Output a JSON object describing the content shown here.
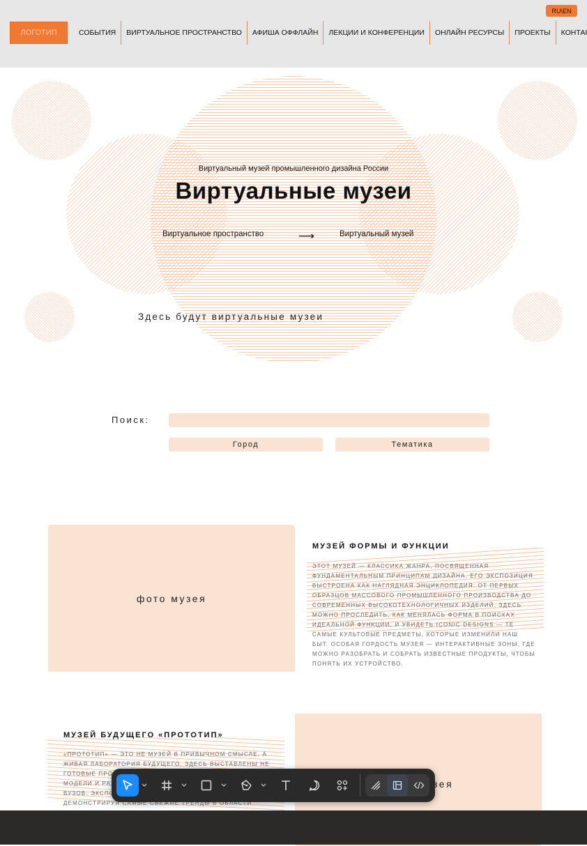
{
  "header": {
    "logo": "ЛОГОТИП",
    "lang": "RU\\EN",
    "nav": [
      {
        "label": "СОБЫТИЯ"
      },
      {
        "label": "ВИРТУАЛЬНОЕ ПРОСТРАНСТВО"
      },
      {
        "label": "АФИША ОФФЛАЙН"
      },
      {
        "label": "ЛЕКЦИИ И КОНФЕРЕНЦИИ"
      },
      {
        "label": "ОНЛАЙН РЕСУРСЫ"
      },
      {
        "label": "ПРОЕКТЫ"
      },
      {
        "label": "КОНТАКТЫ"
      }
    ]
  },
  "hero": {
    "subtitle": "Виртуальный музей промышленного дизайна России",
    "title": "Виртуальные музеи",
    "from": "Виртуальное пространство",
    "arrow": "⟶",
    "to": "Виртуальный музей",
    "note": "Здесь будут виртуальные музеи"
  },
  "search": {
    "label": "Поиск:",
    "value": "",
    "placeholder": "",
    "filters": [
      "Город",
      "Тематика"
    ]
  },
  "museums": [
    {
      "photo": "фото музея",
      "title": "МУЗЕЙ ФОРМЫ И ФУНКЦИИ",
      "text": "Этот музей — классика жанра, посвященная фундаментальным принципам дизайна. Его экспозиция выстроена как наглядная энциклопедия: от первых образцов массового промышленного производства до современных высокотехнологичных изделий. Здесь можно проследить, как менялась форма в поисках идеальной функции, и увидеть iconic designs — те самые культовые предметы, которые изменили наш быт. Особая гордость музея — интерактивные зоны, где можно разобрать и собрать известные продукты, чтобы понять их устройство."
    },
    {
      "photo": "фото музея",
      "title": "МУЗЕЙ БУДУЩЕГО «ПРОТОТИП»",
      "text": "«Прототип» — это не музей в привычном смысле, а живая лаборатория будущего. Здесь выставлены не готовые продукты, а концепции, прототипы, модели и разработки молодых дизайнеров, студий и вузов. Экспозиция постоянно обновляется, демонстрируя самые свежие тренды в области"
    }
  ],
  "toolbar": {
    "tools": [
      "move-tool",
      "frame-tool",
      "shape-tool",
      "pen-tool",
      "text-tool",
      "comment-tool",
      "components-tool"
    ],
    "modes": [
      "draw-mode",
      "design-mode",
      "dev-mode"
    ],
    "active_tool": "move-tool",
    "active_mode": "design-mode",
    "accent": "#1a8cff"
  },
  "colors": {
    "accent": "#f07a32",
    "peach": "#fbe3d4",
    "header_bg": "#e8e7e7"
  }
}
